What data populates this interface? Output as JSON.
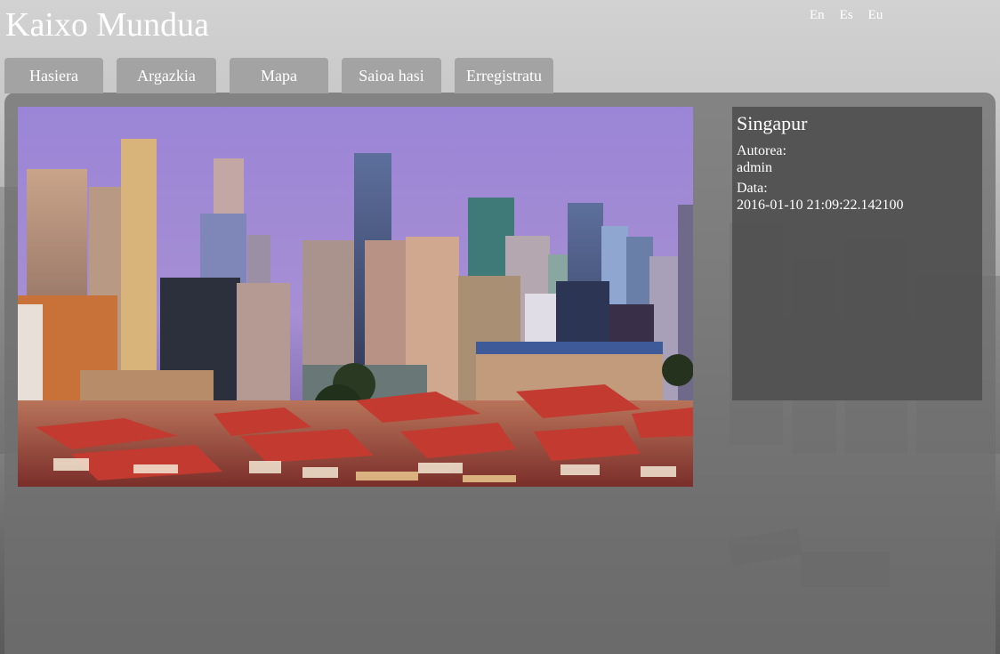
{
  "site": {
    "title": "Kaixo Mundua"
  },
  "languages": [
    "En",
    "Es",
    "Eu"
  ],
  "tabs": [
    "Hasiera",
    "Argazkia",
    "Mapa",
    "Saioa hasi",
    "Erregistratu"
  ],
  "photo": {
    "title": "Singapur",
    "author_label": "Autorea:",
    "author": "admin",
    "date_label": "Data:",
    "date": "2016-01-10 21:09:22.142100"
  },
  "colors": {
    "tab_bg": "#a3a3a3",
    "panel_bg": "#707070",
    "info_bg": "#505050",
    "text": "#ffffff"
  }
}
